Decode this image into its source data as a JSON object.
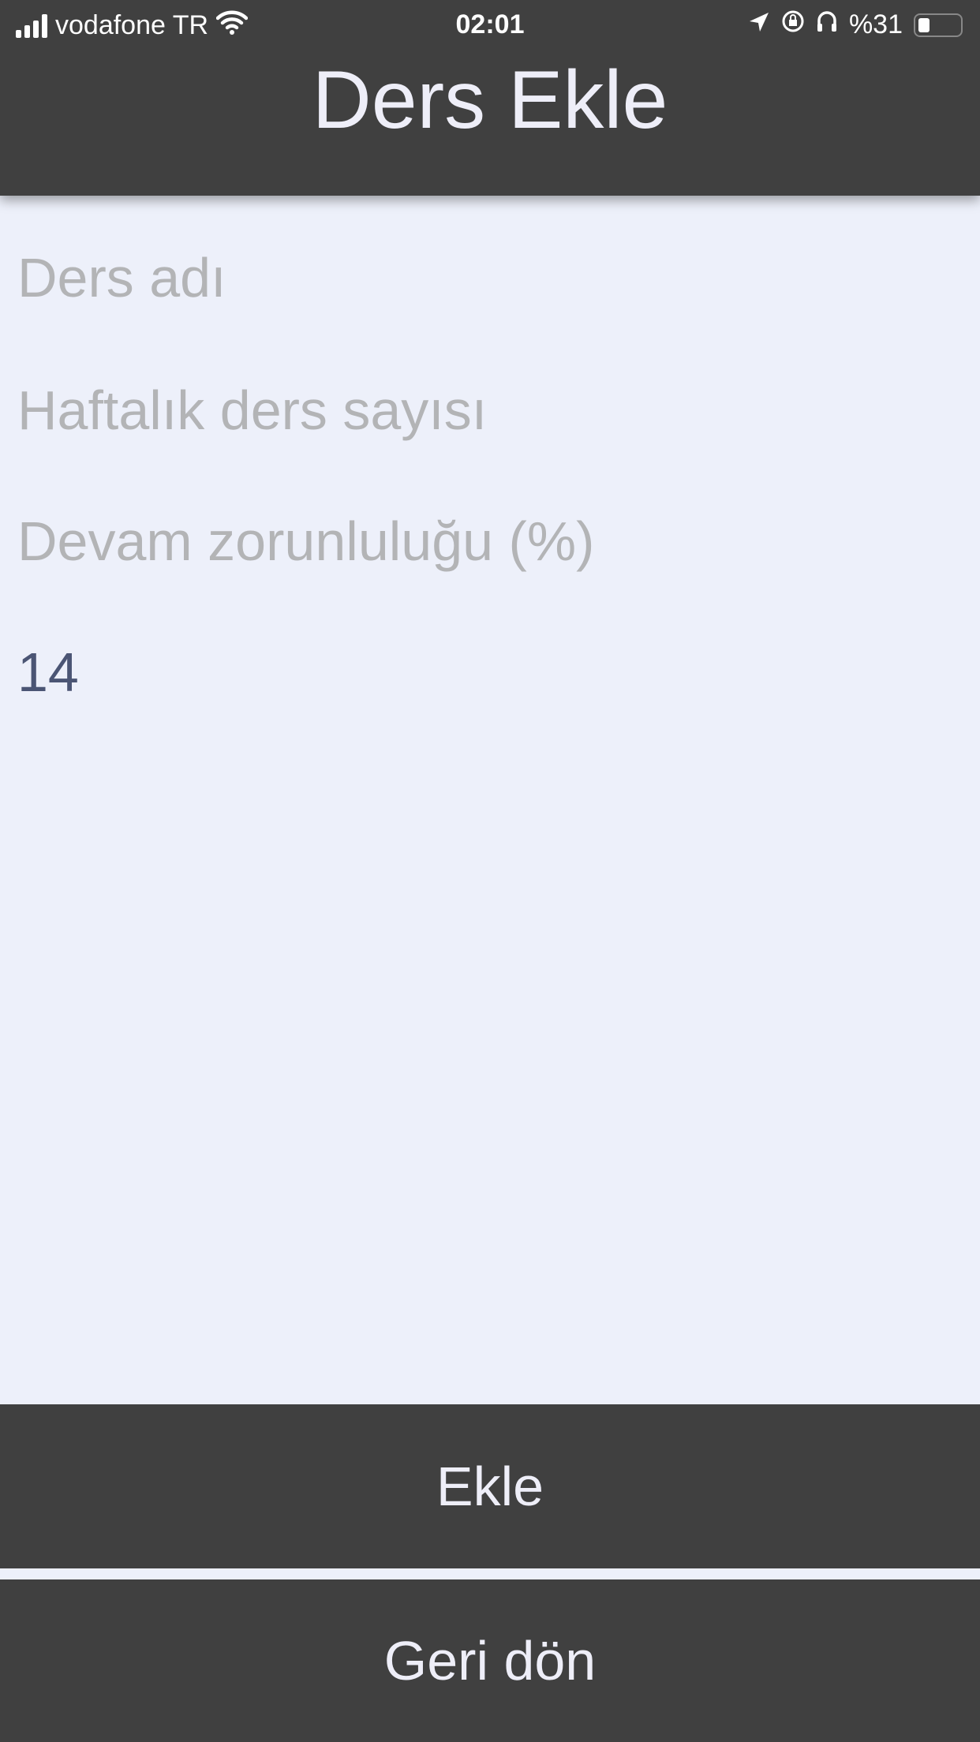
{
  "status_bar": {
    "carrier": "vodafone TR",
    "time": "02:01",
    "battery": "%31"
  },
  "header": {
    "title": "Ders Ekle"
  },
  "form": {
    "course_name": {
      "placeholder": "Ders adı",
      "value": ""
    },
    "weekly_count": {
      "placeholder": "Haftalık ders sayısı",
      "value": ""
    },
    "attendance": {
      "placeholder": "Devam zorunluluğu (%)",
      "value": ""
    },
    "extra": {
      "value": "14"
    }
  },
  "buttons": {
    "add": "Ekle",
    "back": "Geri dön"
  }
}
